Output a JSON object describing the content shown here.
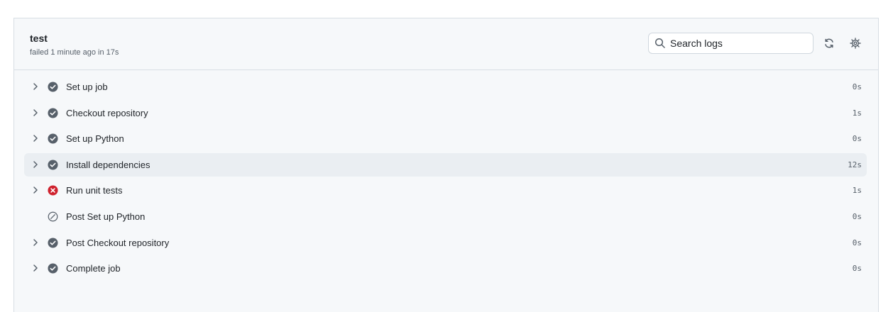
{
  "job": {
    "title": "test",
    "meta": "failed 1 minute ago in 17s"
  },
  "search": {
    "placeholder": "Search logs",
    "icon": "search-icon"
  },
  "header_actions": [
    {
      "name": "refresh",
      "icon": "sync-icon"
    },
    {
      "name": "settings",
      "icon": "gear-icon"
    }
  ],
  "colors": {
    "success": "#57606a",
    "failure": "#cf222e",
    "skipped": "#57606a",
    "highlight": "#eaeef2"
  },
  "steps": [
    {
      "name": "Set up job",
      "duration": "0s",
      "status": "success",
      "expandable": true
    },
    {
      "name": "Checkout repository",
      "duration": "1s",
      "status": "success",
      "expandable": true
    },
    {
      "name": "Set up Python",
      "duration": "0s",
      "status": "success",
      "expandable": true
    },
    {
      "name": "Install dependencies",
      "duration": "12s",
      "status": "success",
      "expandable": true,
      "highlighted": true
    },
    {
      "name": "Run unit tests",
      "duration": "1s",
      "status": "failure",
      "expandable": true
    },
    {
      "name": "Post Set up Python",
      "duration": "0s",
      "status": "skipped",
      "expandable": false
    },
    {
      "name": "Post Checkout repository",
      "duration": "0s",
      "status": "success",
      "expandable": true
    },
    {
      "name": "Complete job",
      "duration": "0s",
      "status": "success",
      "expandable": true
    }
  ]
}
